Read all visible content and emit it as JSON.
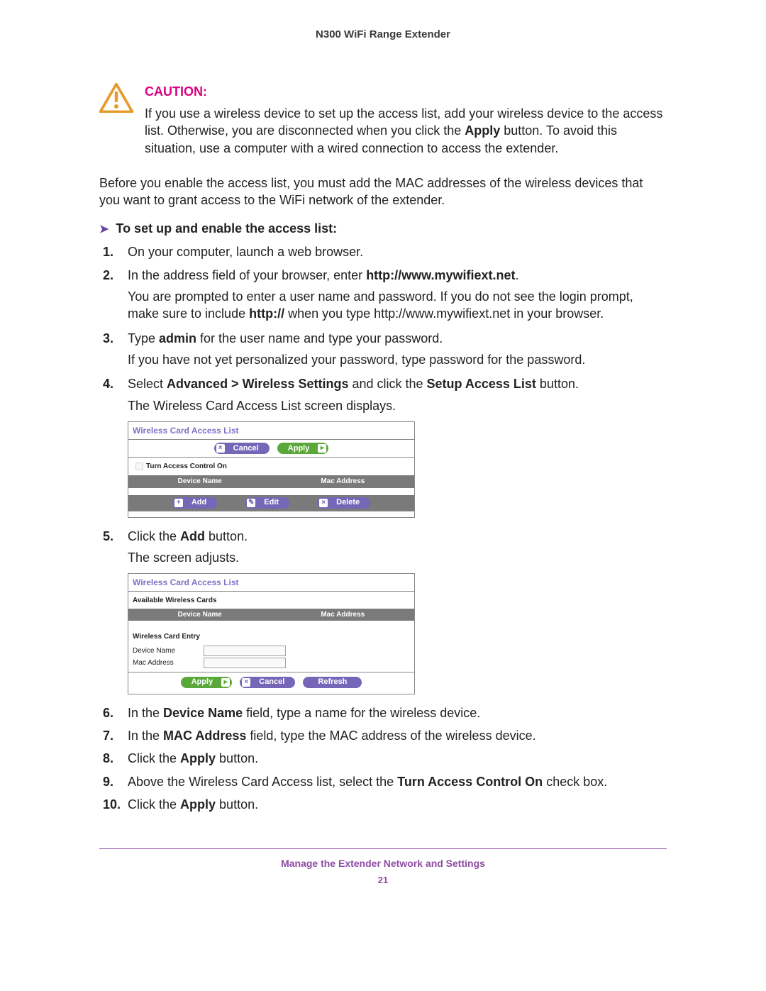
{
  "header": {
    "title": "N300 WiFi Range Extender"
  },
  "caution": {
    "heading": "CAUTION:",
    "text_p1": "If you use a wireless device to set up the access list, add your wireless device to the access list. Otherwise, you are disconnected when you click the ",
    "text_bold": "Apply",
    "text_p2": " button. To avoid this situation, use a computer with a wired connection to access the extender."
  },
  "intro": "Before you enable the access list, you must add the MAC addresses of the wireless devices that you want to grant access to the WiFi network of the extender.",
  "task_heading": "To set up and enable the access list:",
  "steps": {
    "s1": "On your computer, launch a web browser.",
    "s2_a": "In the address field of your browser, enter ",
    "s2_b": "http://www.mywifiext.net",
    "s2_c": ".",
    "s2_sub_a": "You are prompted to enter a user name and password. If you do not see the login prompt, make sure to include ",
    "s2_sub_b": "http://",
    "s2_sub_c": " when you type http://www.mywifiext.net in your browser.",
    "s3_a": "Type ",
    "s3_b": "admin",
    "s3_c": " for the user name and type your password.",
    "s3_sub": "If you have not yet personalized your password, type password for the password.",
    "s4_a": "Select ",
    "s4_b": "Advanced > Wireless Settings",
    "s4_c": " and click the ",
    "s4_d": "Setup Access List",
    "s4_e": " button.",
    "s4_sub": "The Wireless Card Access List screen displays.",
    "s5_a": "Click the ",
    "s5_b": "Add",
    "s5_c": " button.",
    "s5_sub": "The screen adjusts.",
    "s6_a": "In the ",
    "s6_b": "Device Name",
    "s6_c": " field, type a name for the wireless device.",
    "s7_a": "In the ",
    "s7_b": "MAC Address",
    "s7_c": " field, type the MAC address of the wireless device.",
    "s8_a": "Click the ",
    "s8_b": "Apply",
    "s8_c": " button.",
    "s9_a": "Above the Wireless Card Access list, select the ",
    "s9_b": "Turn Access Control On",
    "s9_c": " check box.",
    "s10_a": "Click the ",
    "s10_b": "Apply",
    "s10_c": " button."
  },
  "screenshot1": {
    "title": "Wireless Card Access List",
    "cancel": "Cancel",
    "apply": "Apply",
    "checkbox": "Turn Access Control On",
    "col1": "Device Name",
    "col2": "Mac Address",
    "add": "Add",
    "edit": "Edit",
    "delete": "Delete"
  },
  "screenshot2": {
    "title": "Wireless Card Access List",
    "avail": "Available Wireless Cards",
    "col1": "Device Name",
    "col2": "Mac Address",
    "entry": "Wireless Card Entry",
    "f1": "Device Name",
    "f2": "Mac Address",
    "apply": "Apply",
    "cancel": "Cancel",
    "refresh": "Refresh"
  },
  "footer": {
    "text": "Manage the Extender Network and Settings",
    "page": "21"
  }
}
